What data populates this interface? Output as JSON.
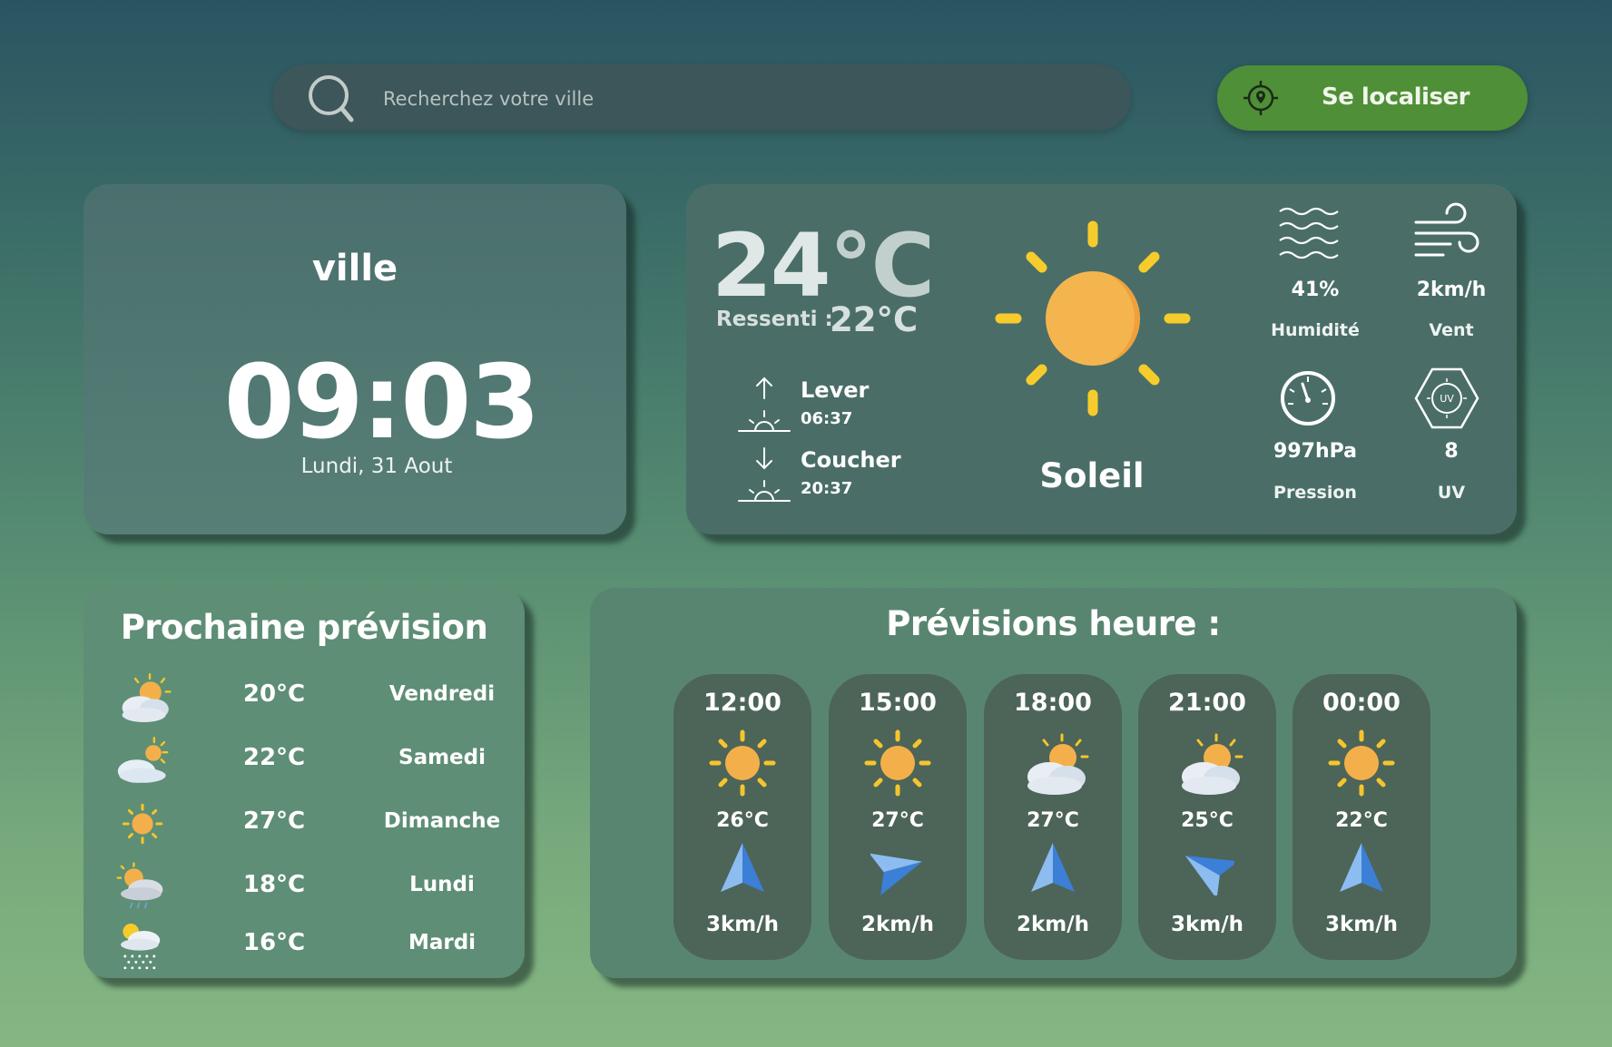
{
  "search": {
    "placeholder": "Recherchez votre ville"
  },
  "locate_button": {
    "label": "Se localiser"
  },
  "city_card": {
    "city": "ville",
    "time": "09:03",
    "date": "Lundi, 31 Aout"
  },
  "current": {
    "temp_value": "24",
    "temp_unit": "°C",
    "feels_label": "Ressenti :",
    "feels_value": "22°C",
    "sunrise": {
      "label": "Lever",
      "time": "06:37"
    },
    "sunset": {
      "label": "Coucher",
      "time": "20:37"
    },
    "condition": "Soleil",
    "condition_icon": "sun-icon",
    "stats": [
      {
        "icon": "humidity-icon",
        "value": "41%",
        "label": "Humidité"
      },
      {
        "icon": "wind-icon",
        "value": "2km/h",
        "label": "Vent"
      },
      {
        "icon": "pressure-icon",
        "value": "997hPa",
        "label": "Pression"
      },
      {
        "icon": "uv-icon",
        "value": "8",
        "label": "UV"
      }
    ]
  },
  "daily": {
    "title": "Prochaine prévision",
    "items": [
      {
        "icon": "cloud-sun-icon",
        "temp": "20°C",
        "day": "Vendredi"
      },
      {
        "icon": "sun-behind-cloud-icon",
        "temp": "22°C",
        "day": "Samedi"
      },
      {
        "icon": "sun-icon",
        "temp": "27°C",
        "day": "Dimanche"
      },
      {
        "icon": "sun-rain-cloud-icon",
        "temp": "18°C",
        "day": "Lundi"
      },
      {
        "icon": "sun-snow-cloud-icon",
        "temp": "16°C",
        "day": "Mardi"
      }
    ]
  },
  "hourly": {
    "title": "Prévisions heure :",
    "items": [
      {
        "time": "12:00",
        "icon": "sun-icon",
        "temp": "26°C",
        "wind_dir_icon": "wind-direction-north-icon",
        "wind": "3km/h"
      },
      {
        "time": "15:00",
        "icon": "sun-icon",
        "temp": "27°C",
        "wind_dir_icon": "wind-direction-east-icon",
        "wind": "2km/h"
      },
      {
        "time": "18:00",
        "icon": "cloud-sun-icon",
        "temp": "27°C",
        "wind_dir_icon": "wind-direction-north-icon",
        "wind": "2km/h"
      },
      {
        "time": "21:00",
        "icon": "cloud-sun-icon",
        "temp": "25°C",
        "wind_dir_icon": "wind-direction-west-icon",
        "wind": "3km/h"
      },
      {
        "time": "00:00",
        "icon": "sun-icon",
        "temp": "22°C",
        "wind_dir_icon": "wind-direction-north-icon",
        "wind": "3km/h"
      }
    ]
  },
  "colors": {
    "accent_green": "#4f8f37",
    "sun_orange": "#f3b34a",
    "sun_ray": "#f6cc2c",
    "arrow_blue": "#4a90e2"
  }
}
